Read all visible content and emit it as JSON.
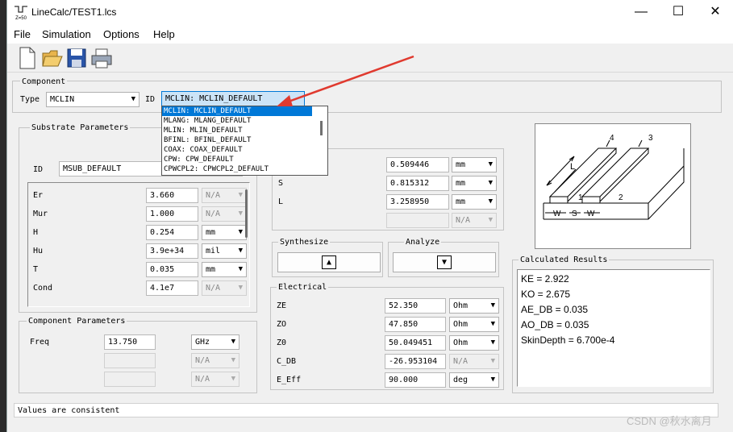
{
  "window": {
    "title": "LineCalc/TEST1.lcs",
    "icon_text": "Z=50",
    "minimize": "—",
    "maximize": "☐",
    "close": "✕"
  },
  "menu": [
    "File",
    "Simulation",
    "Options",
    "Help"
  ],
  "component": {
    "group_label": "Component",
    "type_label": "Type",
    "type_value": "MCLIN",
    "id_label": "ID",
    "id_value": "MCLIN: MCLIN_DEFAULT",
    "dropdown_options": [
      "MCLIN: MCLIN_DEFAULT",
      "MLANG: MLANG_DEFAULT",
      "MLIN: MLIN_DEFAULT",
      "BFINL: BFINL_DEFAULT",
      "COAX: COAX_DEFAULT",
      "CPW: CPW_DEFAULT",
      "CPWCPL2: CPWCPL2_DEFAULT"
    ]
  },
  "substrate": {
    "group_label": "Substrate Parameters",
    "id_label": "ID",
    "id_value": "MSUB_DEFAULT",
    "rows": [
      {
        "label": "Er",
        "value": "3.660",
        "unit": "N/A",
        "enabled": false
      },
      {
        "label": "Mur",
        "value": "1.000",
        "unit": "N/A",
        "enabled": false
      },
      {
        "label": "H",
        "value": "0.254",
        "unit": "mm",
        "enabled": true
      },
      {
        "label": "Hu",
        "value": "3.9e+34",
        "unit": "mil",
        "enabled": true
      },
      {
        "label": "T",
        "value": "0.035",
        "unit": "mm",
        "enabled": true
      },
      {
        "label": "Cond",
        "value": "4.1e7",
        "unit": "N/A",
        "enabled": false
      }
    ]
  },
  "physical": {
    "rows": [
      {
        "label": "",
        "value": "0.509446",
        "unit": "mm",
        "enabled": true
      },
      {
        "label": "S",
        "value": "0.815312",
        "unit": "mm",
        "enabled": true
      },
      {
        "label": "L",
        "value": "3.258950",
        "unit": "mm",
        "enabled": true
      },
      {
        "label": "",
        "value": "",
        "unit": "N/A",
        "enabled": false
      }
    ]
  },
  "synthesize": {
    "label": "Synthesize",
    "glyph": "▲"
  },
  "analyze": {
    "label": "Analyze",
    "glyph": "▼"
  },
  "component_params": {
    "group_label": "Component Parameters",
    "rows": [
      {
        "label": "Freq",
        "value": "13.750",
        "unit": "GHz",
        "enabled": true
      },
      {
        "label": "",
        "value": "",
        "unit": "N/A",
        "enabled": false
      },
      {
        "label": "",
        "value": "",
        "unit": "N/A",
        "enabled": false
      }
    ]
  },
  "electrical": {
    "group_label": "Electrical",
    "rows": [
      {
        "label": "ZE",
        "value": "52.350",
        "unit": "Ohm",
        "enabled": true
      },
      {
        "label": "ZO",
        "value": "47.850",
        "unit": "Ohm",
        "enabled": true
      },
      {
        "label": "Z0",
        "value": "50.049451",
        "unit": "Ohm",
        "enabled": true
      },
      {
        "label": "C_DB",
        "value": "-26.953104",
        "unit": "N/A",
        "enabled": false
      },
      {
        "label": "E_Eff",
        "value": "90.000",
        "unit": "deg",
        "enabled": true
      }
    ]
  },
  "diagram": {
    "port1": "1",
    "port2": "2",
    "port3": "3",
    "port4": "4",
    "len": "L",
    "w1": "W",
    "s": "S",
    "w2": "W"
  },
  "results": {
    "group_label": "Calculated Results",
    "lines": [
      "KE = 2.922",
      "KO = 2.675",
      "AE_DB = 0.035",
      "AO_DB = 0.035",
      "SkinDepth = 6.700e-4"
    ]
  },
  "status": "Values are consistent",
  "watermark": "CSDN @秋水离月",
  "colors": {
    "selection": "#0078d7",
    "annotation_arrow": "#e03a2f"
  }
}
